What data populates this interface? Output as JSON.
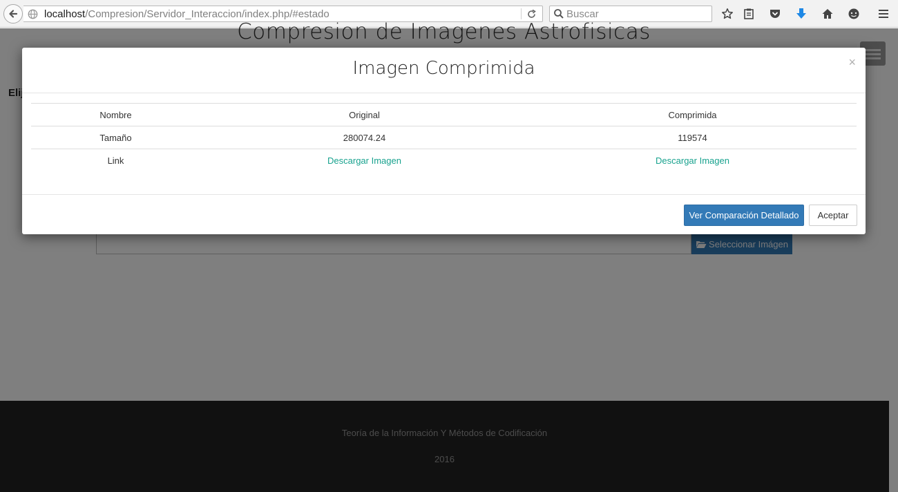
{
  "browser": {
    "url_host": "localhost",
    "url_path": "/Compresion/Servidor_Interaccion/index.php/#estado",
    "search_placeholder": "Buscar"
  },
  "page": {
    "title": "Compresion de Imagenes Astrofisicas",
    "label": "Elij",
    "select_button": "Seleccionar Imágen"
  },
  "modal": {
    "title": "Imagen Comprimida",
    "close": "×",
    "rows": [
      [
        "Nombre",
        "Original",
        "Comprimida"
      ],
      [
        "Tamaño",
        "280074.24",
        "119574"
      ],
      [
        "Link",
        "Descargar Imagen",
        "Descargar Imagen"
      ]
    ],
    "compare_button": "Ver Comparación Detallado",
    "accept_button": "Aceptar"
  },
  "footer": {
    "line1": "Teoría de la Información Y Métodos de Codificación",
    "line2": "2016"
  },
  "colors": {
    "accent": "#337ab7",
    "link": "#18a28e",
    "footer_bg": "#222222",
    "download_icon": "#1e88e5"
  },
  "icons": [
    "back-arrow-icon",
    "globe-icon",
    "reload-icon",
    "search-icon",
    "bookmark-star-icon",
    "reading-list-icon",
    "pocket-icon",
    "download-arrow-icon",
    "home-icon",
    "chat-icon",
    "menu-icon",
    "folder-open-icon"
  ]
}
